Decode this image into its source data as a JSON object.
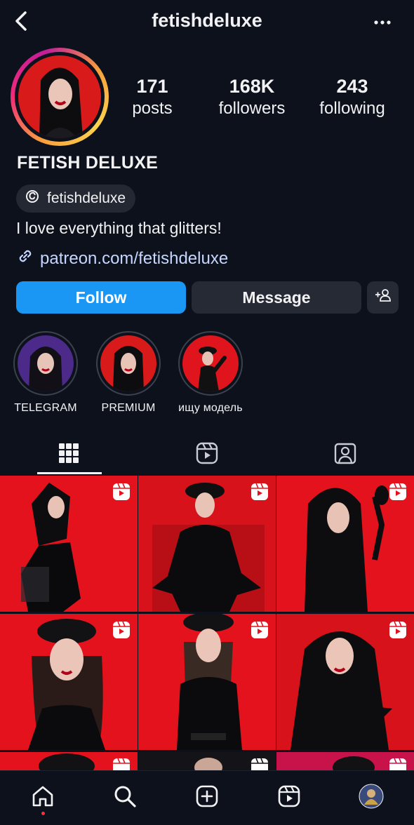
{
  "header": {
    "username": "fetishdeluxe",
    "back_icon": "chevron-left-icon",
    "more_icon": "more-horizontal-icon"
  },
  "profile": {
    "stats": [
      {
        "value": "171",
        "label": "posts"
      },
      {
        "value": "168K",
        "label": "followers"
      },
      {
        "value": "243",
        "label": "following"
      }
    ],
    "full_name": "FETISH DELUXE",
    "threads_handle": "fetishdeluxe",
    "bio": "I love everything that glitters!",
    "link": "patreon.com/fetishdeluxe"
  },
  "actions": {
    "follow_label": "Follow",
    "message_label": "Message",
    "add_user_icon": "add-person-icon"
  },
  "highlights": [
    {
      "label": "TELEGRAM"
    },
    {
      "label": "PREMIUM"
    },
    {
      "label": "ищу модель"
    }
  ],
  "tabs": [
    "grid-icon",
    "reels-icon",
    "tagged-icon"
  ],
  "grid": {
    "posts": [
      {
        "type": "reel"
      },
      {
        "type": "reel"
      },
      {
        "type": "reel"
      },
      {
        "type": "reel"
      },
      {
        "type": "reel"
      },
      {
        "type": "reel"
      },
      {
        "type": "reel"
      },
      {
        "type": "reel"
      },
      {
        "type": "reel"
      }
    ]
  },
  "navbar": [
    "home-icon",
    "search-icon",
    "create-icon",
    "reels-icon",
    "profile-avatar"
  ],
  "colors": {
    "background": "#0c111b",
    "follow_button": "#1a96f5",
    "secondary_button": "#252a35",
    "accent_red": "#e3121c",
    "notification_dot": "#ff3040"
  }
}
